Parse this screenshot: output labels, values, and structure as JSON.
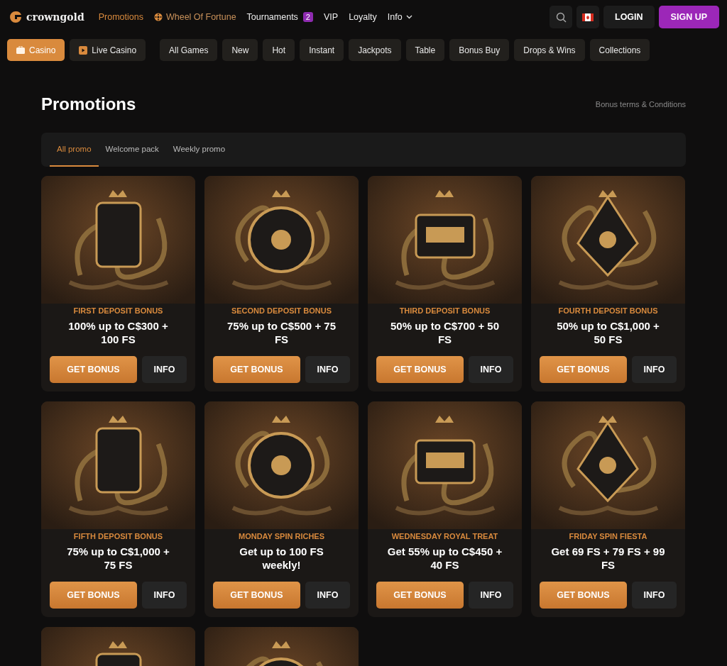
{
  "header": {
    "logo": "crowngold",
    "nav": [
      {
        "label": "Promotions",
        "kind": "link",
        "selected": true
      },
      {
        "label": "Wheel Of Fortune",
        "kind": "wheel",
        "selected": false
      },
      {
        "label": "Tournaments",
        "kind": "badge",
        "badge": "2",
        "selected": false
      },
      {
        "label": "VIP",
        "kind": "link",
        "selected": false
      },
      {
        "label": "Loyalty",
        "kind": "link",
        "selected": false
      },
      {
        "label": "Info",
        "kind": "dropdown",
        "selected": false
      }
    ],
    "login": "LOGIN",
    "signup": "SIGN UP"
  },
  "sections": [
    {
      "label": "Casino",
      "kind": "casino",
      "selected": true
    },
    {
      "label": "Live Casino",
      "kind": "live",
      "selected": false
    }
  ],
  "categories": [
    "All Games",
    "New",
    "Hot",
    "Instant",
    "Jackpots",
    "Table",
    "Bonus Buy",
    "Drops & Wins",
    "Collections"
  ],
  "page": {
    "title": "Promotions",
    "terms_link": "Bonus terms & Conditions"
  },
  "tabs": [
    {
      "label": "All promo",
      "selected": true
    },
    {
      "label": "Welcome pack",
      "selected": false
    },
    {
      "label": "Weekly promo",
      "selected": false
    }
  ],
  "promos": [
    {
      "kind": "full",
      "title": "FIRST DEPOSIT BONUS",
      "offer": "100% up to C$300 + 100 FS",
      "primary": "GET BONUS",
      "secondary": "INFO"
    },
    {
      "kind": "full",
      "title": "SECOND DEPOSIT BONUS",
      "offer": "75% up to C$500 + 75 FS",
      "primary": "GET BONUS",
      "secondary": "INFO"
    },
    {
      "kind": "full",
      "title": "THIRD DEPOSIT BONUS",
      "offer": "50% up to C$700 + 50 FS",
      "primary": "GET BONUS",
      "secondary": "INFO"
    },
    {
      "kind": "full",
      "title": "FOURTH DEPOSIT BONUS",
      "offer": "50% up to C$1,000 + 50 FS",
      "primary": "GET BONUS",
      "secondary": "INFO"
    },
    {
      "kind": "full",
      "title": "FIFTH DEPOSIT BONUS",
      "offer": "75% up to C$1,000 + 75 FS",
      "primary": "GET BONUS",
      "secondary": "INFO"
    },
    {
      "kind": "full",
      "title": "MONDAY SPIN RICHES",
      "offer": "Get up to 100 FS weekly!",
      "primary": "GET BONUS",
      "secondary": "INFO"
    },
    {
      "kind": "full",
      "title": "WEDNESDAY ROYAL TREAT",
      "offer": "Get 55% up to C$450 + 40 FS",
      "primary": "GET BONUS",
      "secondary": "INFO"
    },
    {
      "kind": "full",
      "title": "FRIDAY SPIN FIESTA",
      "offer": "Get 69 FS + 79 FS + 99 FS",
      "primary": "GET BONUS",
      "secondary": "INFO"
    },
    {
      "kind": "picture"
    },
    {
      "kind": "picture"
    }
  ]
}
